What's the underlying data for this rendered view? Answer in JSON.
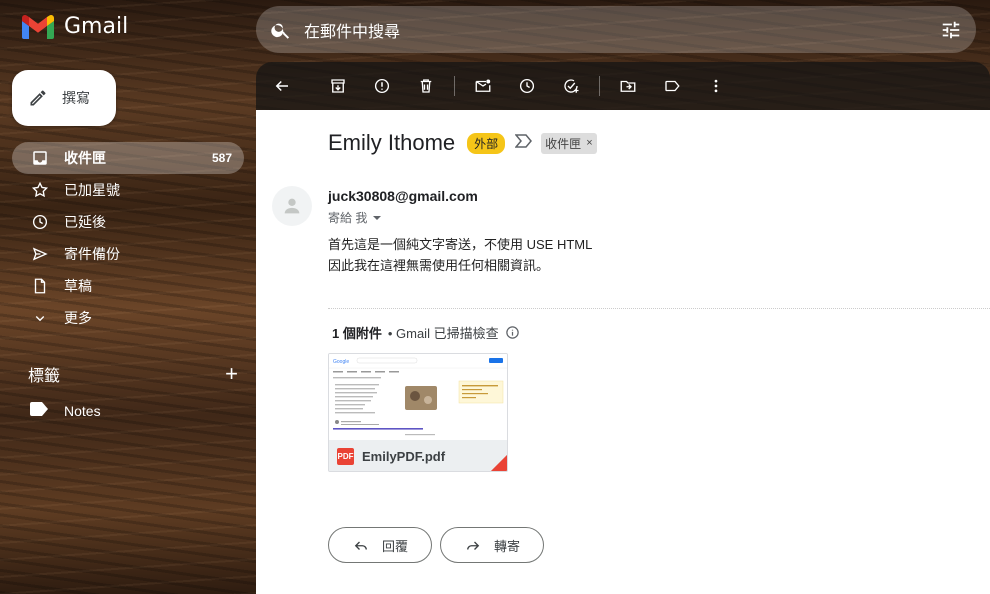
{
  "app": {
    "name": "Gmail"
  },
  "search": {
    "placeholder": "在郵件中搜尋"
  },
  "compose": {
    "label": "撰寫"
  },
  "nav": {
    "items": [
      {
        "label": "收件匣",
        "count": "587",
        "icon": "inbox-icon",
        "active": true
      },
      {
        "label": "已加星號",
        "icon": "star-icon"
      },
      {
        "label": "已延後",
        "icon": "clock-icon"
      },
      {
        "label": "寄件備份",
        "icon": "send-icon"
      },
      {
        "label": "草稿",
        "icon": "draft-icon"
      },
      {
        "label": "更多",
        "icon": "chevron-down-icon"
      }
    ]
  },
  "labels": {
    "title": "標籤",
    "items": [
      {
        "label": "Notes",
        "icon": "label-icon"
      }
    ]
  },
  "toolbar": {
    "icons": [
      "back-arrow-icon",
      "archive-icon",
      "report-spam-icon",
      "delete-icon",
      "mark-unread-icon",
      "snooze-icon",
      "add-task-icon",
      "move-to-icon",
      "label-icon",
      "more-vert-icon"
    ]
  },
  "email": {
    "subject": "Emily Ithome",
    "external_badge": "外部",
    "inbox_badge": "收件匣",
    "sender": "juck30808@gmail.com",
    "to": "寄給 我",
    "body_line1": "首先這是一個純文字寄送，不使用 USE HTML",
    "body_line2": "因此我在這裡無需使用任何相關資訊。"
  },
  "attachments": {
    "count_label": "1 個附件",
    "scan_label": "• Gmail 已掃描檢查",
    "file_name": "EmilyPDF.pdf",
    "file_type": "PDF"
  },
  "actions": {
    "reply": "回覆",
    "forward": "轉寄"
  },
  "colors": {
    "external_badge": "#f5c518",
    "pdf_red": "#ea4335"
  }
}
